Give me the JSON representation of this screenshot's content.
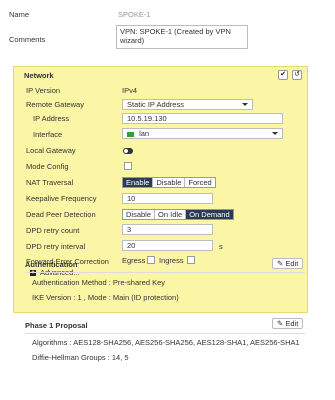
{
  "form": {
    "name_label": "Name",
    "name_value": "SPOKE-1",
    "comments_label": "Comments",
    "comments_value": "VPN: SPOKE-1 (Created by VPN wizard)"
  },
  "network": {
    "title": "Network",
    "ip_version_label": "IP Version",
    "ip_version_value": "IPv4",
    "remote_gateway_label": "Remote Gateway",
    "remote_gateway_value": "Static IP Address",
    "ip_address_label": "IP Address",
    "ip_address_value": "10.5.19.130",
    "interface_label": "Interface",
    "interface_value": "lan",
    "local_gateway_label": "Local Gateway",
    "local_gateway_enabled": false,
    "mode_config_label": "Mode Config",
    "mode_config_checked": false,
    "nat_traversal_label": "NAT Traversal",
    "nat_options": [
      "Enable",
      "Disable",
      "Forced"
    ],
    "nat_selected": "Enable",
    "keepalive_label": "Keepalive Frequency",
    "keepalive_value": "10",
    "dpd_label": "Dead Peer Detection",
    "dpd_options": [
      "Disable",
      "On Idle",
      "On Demand"
    ],
    "dpd_selected": "On Demand",
    "dpd_retry_count_label": "DPD retry count",
    "dpd_retry_count_value": "3",
    "dpd_retry_interval_label": "DPD retry interval",
    "dpd_retry_interval_value": "20",
    "dpd_retry_interval_unit": "s",
    "fec_label": "Forward Error Correction",
    "fec_egress_label": "Egress",
    "fec_ingress_label": "Ingress",
    "advanced_label": "Advanced..."
  },
  "authentication": {
    "title": "Authentication",
    "edit_label": "Edit",
    "method_text": "Authentication Method : Pre-shared Key",
    "ike_text": "IKE Version : 1 , Mode : Main (ID protection)"
  },
  "phase1": {
    "title": "Phase 1 Proposal",
    "edit_label": "Edit",
    "algorithms_text": "Algorithms : AES128-SHA256, AES256-SHA256, AES128-SHA1, AES256-SHA1",
    "dh_text": "Diffie-Hellman Groups : 14, 5"
  },
  "colors": {
    "network_bg": "#fbf6a6",
    "selected_segment": "#2b3a55"
  }
}
